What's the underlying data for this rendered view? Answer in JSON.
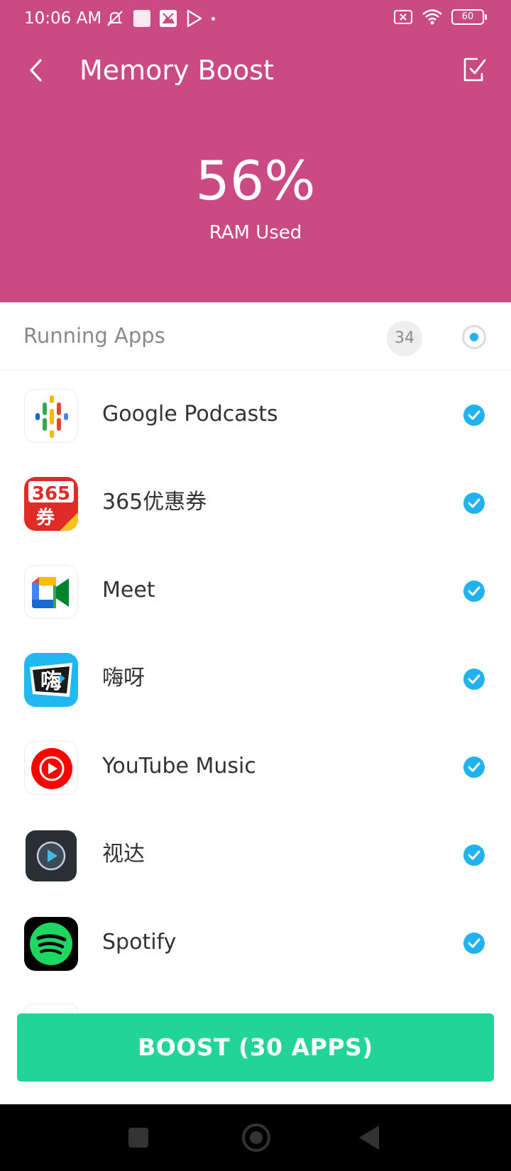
{
  "status_bar": {
    "time": "10:06 AM",
    "battery": "60"
  },
  "header": {
    "title": "Memory Boost",
    "ram_percent": "56%",
    "ram_label": "RAM Used"
  },
  "running": {
    "title": "Running Apps",
    "count": "34"
  },
  "apps": [
    {
      "name": "Google Podcasts",
      "icon": "google-podcasts-icon",
      "checked": true
    },
    {
      "name": "365优惠券",
      "icon": "365-coupon-icon",
      "checked": true
    },
    {
      "name": "Meet",
      "icon": "google-meet-icon",
      "checked": true
    },
    {
      "name": "嗨呀",
      "icon": "haiya-icon",
      "checked": true
    },
    {
      "name": "YouTube Music",
      "icon": "youtube-music-icon",
      "checked": true
    },
    {
      "name": "视达",
      "icon": "shida-icon",
      "checked": true
    },
    {
      "name": "Spotify",
      "icon": "spotify-icon",
      "checked": true
    }
  ],
  "boost_button": {
    "label": "BOOST (30 APPS)"
  },
  "colors": {
    "header_bg": "#cb4a83",
    "accent_blue": "#1fb2ee",
    "boost_green": "#22d497"
  }
}
